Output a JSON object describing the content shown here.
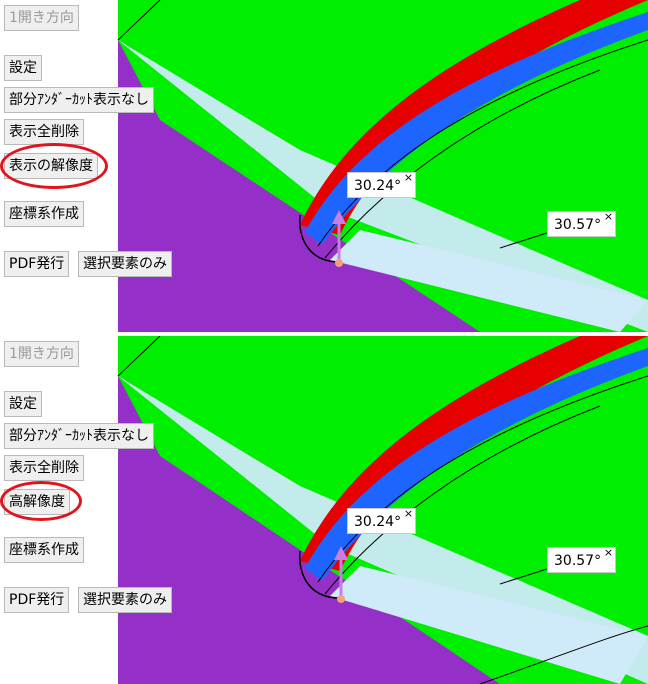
{
  "top": {
    "buttons": {
      "open_direction": "1開き方向",
      "settings": "設定",
      "partial_undercut": "部分ｱﾝﾀﾞｰｶｯﾄ表示なし",
      "clear_display": "表示全削除",
      "resolution": "表示の解像度",
      "create_coordinate": "座標系作成",
      "pdf_issue": "PDF発行",
      "selected_only": "選択要素のみ"
    },
    "angles": {
      "a1": "30.24°",
      "a2": "30.57°"
    },
    "close_glyph": "×"
  },
  "bottom": {
    "buttons": {
      "open_direction": "1開き方向",
      "settings": "設定",
      "partial_undercut": "部分ｱﾝﾀﾞｰｶｯﾄ表示なし",
      "clear_display": "表示全削除",
      "resolution": "高解像度",
      "create_coordinate": "座標系作成",
      "pdf_issue": "PDF発行",
      "selected_only": "選択要素のみ"
    },
    "angles": {
      "a1": "30.24°",
      "a2": "30.57°"
    },
    "close_glyph": "×"
  },
  "colors": {
    "green": "#00ee00",
    "purple": "#9430c8",
    "light_blue": "#cfeaf8",
    "red": "#e60000",
    "blue": "#1e64ff",
    "highlight_ellipse": "#e0141e",
    "arrow": "#c87ee6",
    "origin_point": "#f4a080"
  }
}
